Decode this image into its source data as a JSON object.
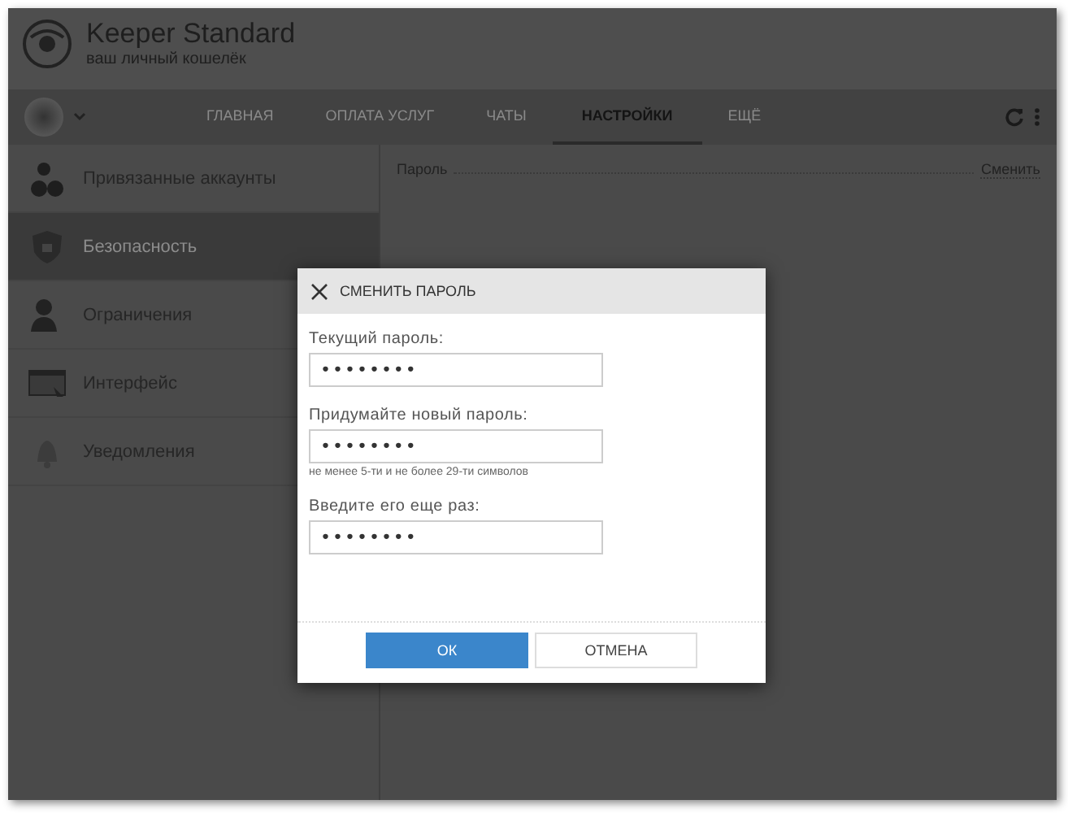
{
  "app": {
    "title": "Keeper Standard",
    "subtitle": "ваш личный кошелёк"
  },
  "nav": {
    "tabs": [
      {
        "label": "ГЛАВНАЯ",
        "selected": false
      },
      {
        "label": "ОПЛАТА УСЛУГ",
        "selected": false
      },
      {
        "label": "ЧАТЫ",
        "selected": false
      },
      {
        "label": "НАСТРОЙКИ",
        "selected": true
      },
      {
        "label": "ЕЩЁ",
        "selected": false
      }
    ]
  },
  "sidebar": {
    "items": [
      {
        "label": "Привязанные аккаунты",
        "kind": "accounts",
        "selected": false
      },
      {
        "label": "Безопасность",
        "kind": "security",
        "selected": true
      },
      {
        "label": "Ограничения",
        "kind": "limits",
        "selected": false
      },
      {
        "label": "Интерфейс",
        "kind": "interface",
        "selected": false
      },
      {
        "label": "Уведомления",
        "kind": "notifications",
        "selected": false
      }
    ]
  },
  "settings": {
    "rows": [
      {
        "label": "Пароль",
        "action": "Сменить"
      }
    ]
  },
  "dialog": {
    "title": "СМЕНИТЬ ПАРОЛЬ",
    "fields": [
      {
        "label": "Текущий пароль:",
        "value": "••••••••"
      },
      {
        "label": "Придумайте новый пароль:",
        "value": "••••••••",
        "hint": "не менее 5-ти и не более 29-ти символов"
      },
      {
        "label": "Введите его еще раз:",
        "value": "••••••••"
      }
    ],
    "buttons": [
      {
        "label": "ОК",
        "kind": "primary"
      },
      {
        "label": "ОТМЕНА",
        "kind": "secondary"
      }
    ]
  }
}
